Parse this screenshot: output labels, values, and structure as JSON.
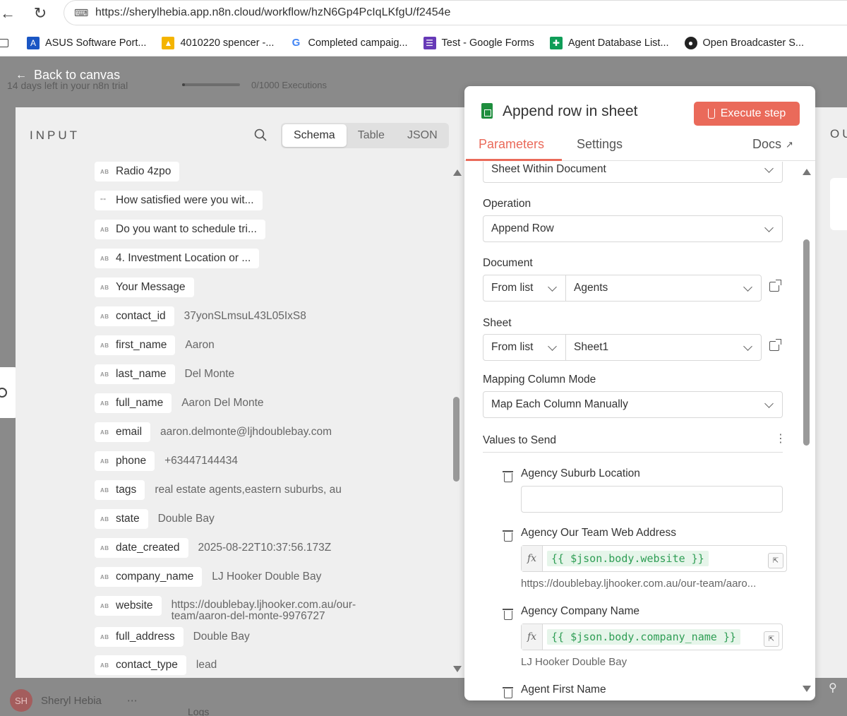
{
  "browser": {
    "url": "https://sherylhebia.app.n8n.cloud/workflow/hzN6Gp4PcIqLKfgU/f2454e",
    "bookmarks": [
      {
        "label": "ASUS Software Port...",
        "icon": "asus-icon",
        "color": "#1a56c4"
      },
      {
        "label": "4010220 spencer -...",
        "icon": "google-drive-icon",
        "color": "#f4b400"
      },
      {
        "label": "Completed campaig...",
        "icon": "google-icon",
        "color": "#4285f4"
      },
      {
        "label": "Test - Google Forms",
        "icon": "google-forms-icon",
        "color": "#673ab7"
      },
      {
        "label": "Agent Database List...",
        "icon": "google-sheets-icon",
        "color": "#0f9d58"
      },
      {
        "label": "Open Broadcaster S...",
        "icon": "obs-icon",
        "color": "#222222"
      }
    ]
  },
  "app": {
    "back_label": "Back to canvas",
    "trial_text": "14 days left in your n8n trial",
    "trial_progress": 0.0,
    "executions": "0/1000 Executions",
    "user_name": "Sheryl Hebia",
    "user_initials": "SH",
    "logs_label": "Logs",
    "output_label": "OU"
  },
  "input": {
    "title": "INPUT",
    "tabs": [
      "Schema",
      "Table",
      "JSON"
    ],
    "active_tab": "Schema",
    "rows": [
      {
        "type": "AB",
        "key": "Radio 4zpo",
        "value": ""
      },
      {
        "type": "\"\"",
        "key": "How satisfied were you wit...",
        "value": ""
      },
      {
        "type": "AB",
        "key": "Do you want to schedule tri...",
        "value": ""
      },
      {
        "type": "AB",
        "key": "4. Investment Location or ...",
        "value": ""
      },
      {
        "type": "AB",
        "key": "Your Message",
        "value": ""
      },
      {
        "type": "AB",
        "key": "contact_id",
        "value": "37yonSLmsuL43L05IxS8"
      },
      {
        "type": "AB",
        "key": "first_name",
        "value": "Aaron"
      },
      {
        "type": "AB",
        "key": "last_name",
        "value": "Del Monte"
      },
      {
        "type": "AB",
        "key": "full_name",
        "value": "Aaron Del Monte"
      },
      {
        "type": "AB",
        "key": "email",
        "value": "aaron.delmonte@ljhdoublebay.com"
      },
      {
        "type": "AB",
        "key": "phone",
        "value": "+63447144434"
      },
      {
        "type": "AB",
        "key": "tags",
        "value": "real estate agents,eastern suburbs, au"
      },
      {
        "type": "AB",
        "key": "state",
        "value": "Double Bay"
      },
      {
        "type": "AB",
        "key": "date_created",
        "value": "2025-08-22T10:37:56.173Z"
      },
      {
        "type": "AB",
        "key": "company_name",
        "value": "LJ Hooker Double Bay"
      },
      {
        "type": "AB",
        "key": "website",
        "value": "https://doublebay.ljhooker.com.au/our-team/aaron-del-monte-9976727"
      },
      {
        "type": "AB",
        "key": "full_address",
        "value": "Double Bay"
      },
      {
        "type": "AB",
        "key": "contact_type",
        "value": "lead"
      }
    ]
  },
  "node": {
    "title": "Append row in sheet",
    "execute_label": "Execute step",
    "tabs": {
      "parameters": "Parameters",
      "settings": "Settings",
      "docs": "Docs"
    },
    "sheet_within_document": "Sheet Within Document",
    "operation": {
      "label": "Operation",
      "value": "Append Row"
    },
    "document": {
      "label": "Document",
      "mode": "From list",
      "value": "Agents"
    },
    "sheet": {
      "label": "Sheet",
      "mode": "From list",
      "value": "Sheet1"
    },
    "mapping": {
      "label": "Mapping Column Mode",
      "value": "Map Each Column Manually"
    },
    "values_label": "Values to Send",
    "fields": [
      {
        "label": "Agency Suburb Location",
        "expr": "",
        "preview": ""
      },
      {
        "label": "Agency Our Team Web Address",
        "expr": "{{ $json.body.website }}",
        "preview": "https://doublebay.ljhooker.com.au/our-team/aaro..."
      },
      {
        "label": "Agency Company Name",
        "expr": "{{ $json.body.company_name }}",
        "preview": "LJ Hooker Double Bay"
      },
      {
        "label": "Agent First Name",
        "expr": "",
        "preview": ""
      }
    ]
  },
  "colors": {
    "accent": "#ea6a5a",
    "expr_green": "#2f9e55",
    "sheets_green": "#1e8e3e"
  }
}
